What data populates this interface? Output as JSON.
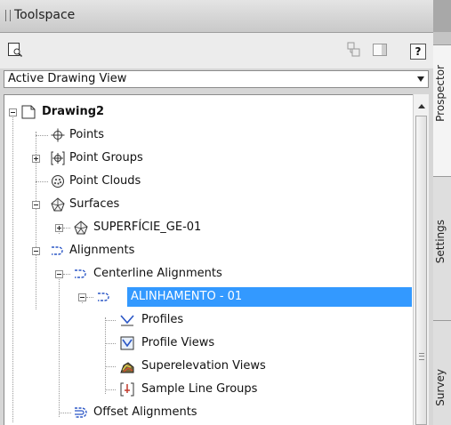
{
  "window": {
    "title": "Toolspace"
  },
  "toolbar": {
    "help_label": "?"
  },
  "view_selector": {
    "selected": "Active Drawing View"
  },
  "tree": {
    "root": "Drawing2",
    "items": [
      {
        "label": "Points",
        "icon": "points-icon"
      },
      {
        "label": "Point Groups",
        "icon": "point-groups-icon"
      },
      {
        "label": "Point Clouds",
        "icon": "point-clouds-icon"
      },
      {
        "label": "Surfaces",
        "icon": "surfaces-icon"
      },
      {
        "label": "SUPERFÍCIE_GE-01",
        "icon": "surface-icon"
      },
      {
        "label": "Alignments",
        "icon": "alignments-icon"
      },
      {
        "label": "Centerline Alignments",
        "icon": "centerline-alignments-icon"
      },
      {
        "label": "ALINHAMENTO - 01",
        "icon": "alignment-icon",
        "selected": true
      },
      {
        "label": "Profiles",
        "icon": "profiles-icon"
      },
      {
        "label": "Profile Views",
        "icon": "profile-views-icon"
      },
      {
        "label": "Superelevation Views",
        "icon": "superelevation-views-icon"
      },
      {
        "label": "Sample Line Groups",
        "icon": "sample-line-groups-icon"
      },
      {
        "label": "Offset Alignments",
        "icon": "offset-alignments-icon"
      }
    ]
  },
  "tabs": [
    {
      "label": "Prospector",
      "active": true
    },
    {
      "label": "Settings"
    },
    {
      "label": "Survey"
    }
  ],
  "colors": {
    "selection": "#3399ff",
    "panel": "#ffffff",
    "chrome": "#d6d6d6"
  }
}
